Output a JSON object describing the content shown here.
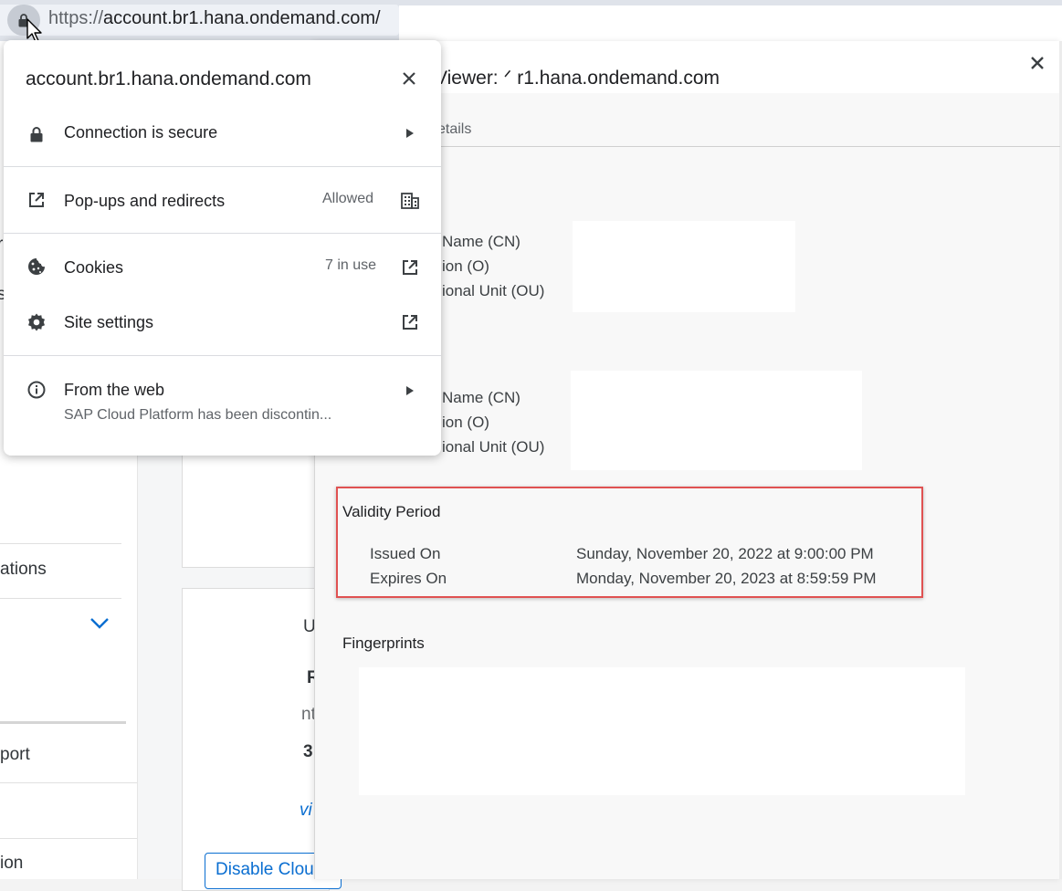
{
  "browser": {
    "url_scheme": "https://",
    "url_host": "account.br1.hana.ondemand.com/"
  },
  "site_info": {
    "host": "account.br1.hana.ondemand.com",
    "connection": {
      "label": "Connection is secure"
    },
    "popups": {
      "label": "Pop-ups and redirects",
      "value": "Allowed"
    },
    "cookies": {
      "label": "Cookies",
      "value": "7 in use"
    },
    "site_settings": {
      "label": "Site settings"
    },
    "from_web": {
      "label": "From the web",
      "subtitle": "SAP Cloud Platform has been discontin..."
    }
  },
  "certificate_viewer": {
    "title": "Viewer: ᐟ   r1.hana.ondemand.com",
    "tab_details": "etails",
    "subject_fields": [
      "Name (CN)",
      "ion (O)",
      "ional Unit (OU)"
    ],
    "issuer_fields": [
      "Name (CN)",
      "ion (O)",
      "ional Unit (OU)"
    ],
    "validity": {
      "title": "Validity Period",
      "issued_label": "Issued On",
      "issued_value": "Sunday, November 20, 2022 at 9:00:00 PM",
      "expires_label": "Expires On",
      "expires_value": "Monday, November 20, 2023 at 8:59:59 PM"
    },
    "fingerprints_title": "Fingerprints"
  },
  "background_page": {
    "nav_items": [
      "ations",
      "port",
      "ion"
    ],
    "nav_partial": [
      "r",
      "s",
      "-"
    ],
    "card_fragments": [
      "U",
      "R",
      "nt",
      "3",
      "vi"
    ],
    "disable_button": "Disable Clou"
  },
  "colors": {
    "highlight_border": "#e05252",
    "link_blue": "#0a6ed1"
  },
  "icons": [
    "lock-icon",
    "close-icon",
    "chevron-right-icon",
    "open-in-new-icon",
    "building-icon",
    "cookie-icon",
    "gear-icon",
    "info-icon",
    "chevron-down-icon"
  ]
}
